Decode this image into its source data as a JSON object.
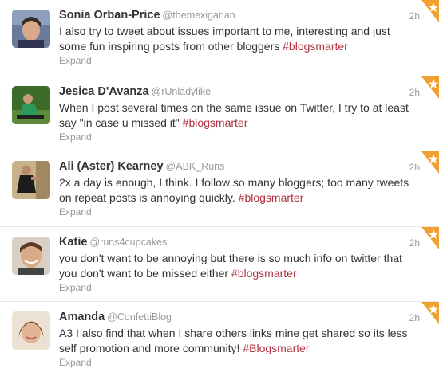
{
  "tweets": [
    {
      "name": "Sonia Orban-Price",
      "handle": "@themexigarian",
      "time": "2h",
      "text": "I also try to tweet about issues important to me, interesting and just some fun inspiring posts from other bloggers ",
      "hashtag": "#blogsmarter",
      "expand": "Expand",
      "avatar_icon": "avatar-photo"
    },
    {
      "name": "Jesica D'Avanza",
      "handle": "@rUnladylike",
      "time": "2h",
      "text": "When I post several times on the same issue on Twitter, I try to at least say \"in case u missed it\" ",
      "hashtag": "#blogsmarter",
      "expand": "Expand",
      "avatar_icon": "avatar-photo"
    },
    {
      "name": "Ali (Aster) Kearney",
      "handle": "@ABK_Runs",
      "time": "2h",
      "text": "2x a day is enough, I think. I follow so many bloggers; too many tweets on repeat posts is annoying quickly. ",
      "hashtag": "#blogsmarter",
      "expand": "Expand",
      "avatar_icon": "avatar-photo"
    },
    {
      "name": "Katie",
      "handle": "@runs4cupcakes",
      "time": "2h",
      "text": "you don't want to be annoying but there is so much info on twitter that you don't want to be missed either ",
      "hashtag": "#blogsmarter",
      "expand": "Expand",
      "avatar_icon": "avatar-photo"
    },
    {
      "name": "Amanda",
      "handle": "@ConfettiBlog",
      "time": "2h",
      "text": "A3 I also find that when I share others links mine get shared so its less self promotion and more community! ",
      "hashtag": "#Blogsmarter",
      "expand": "Expand",
      "avatar_icon": "avatar-photo"
    }
  ],
  "colors": {
    "hashtag": "#b1303f",
    "star_corner": "#f0a030"
  }
}
